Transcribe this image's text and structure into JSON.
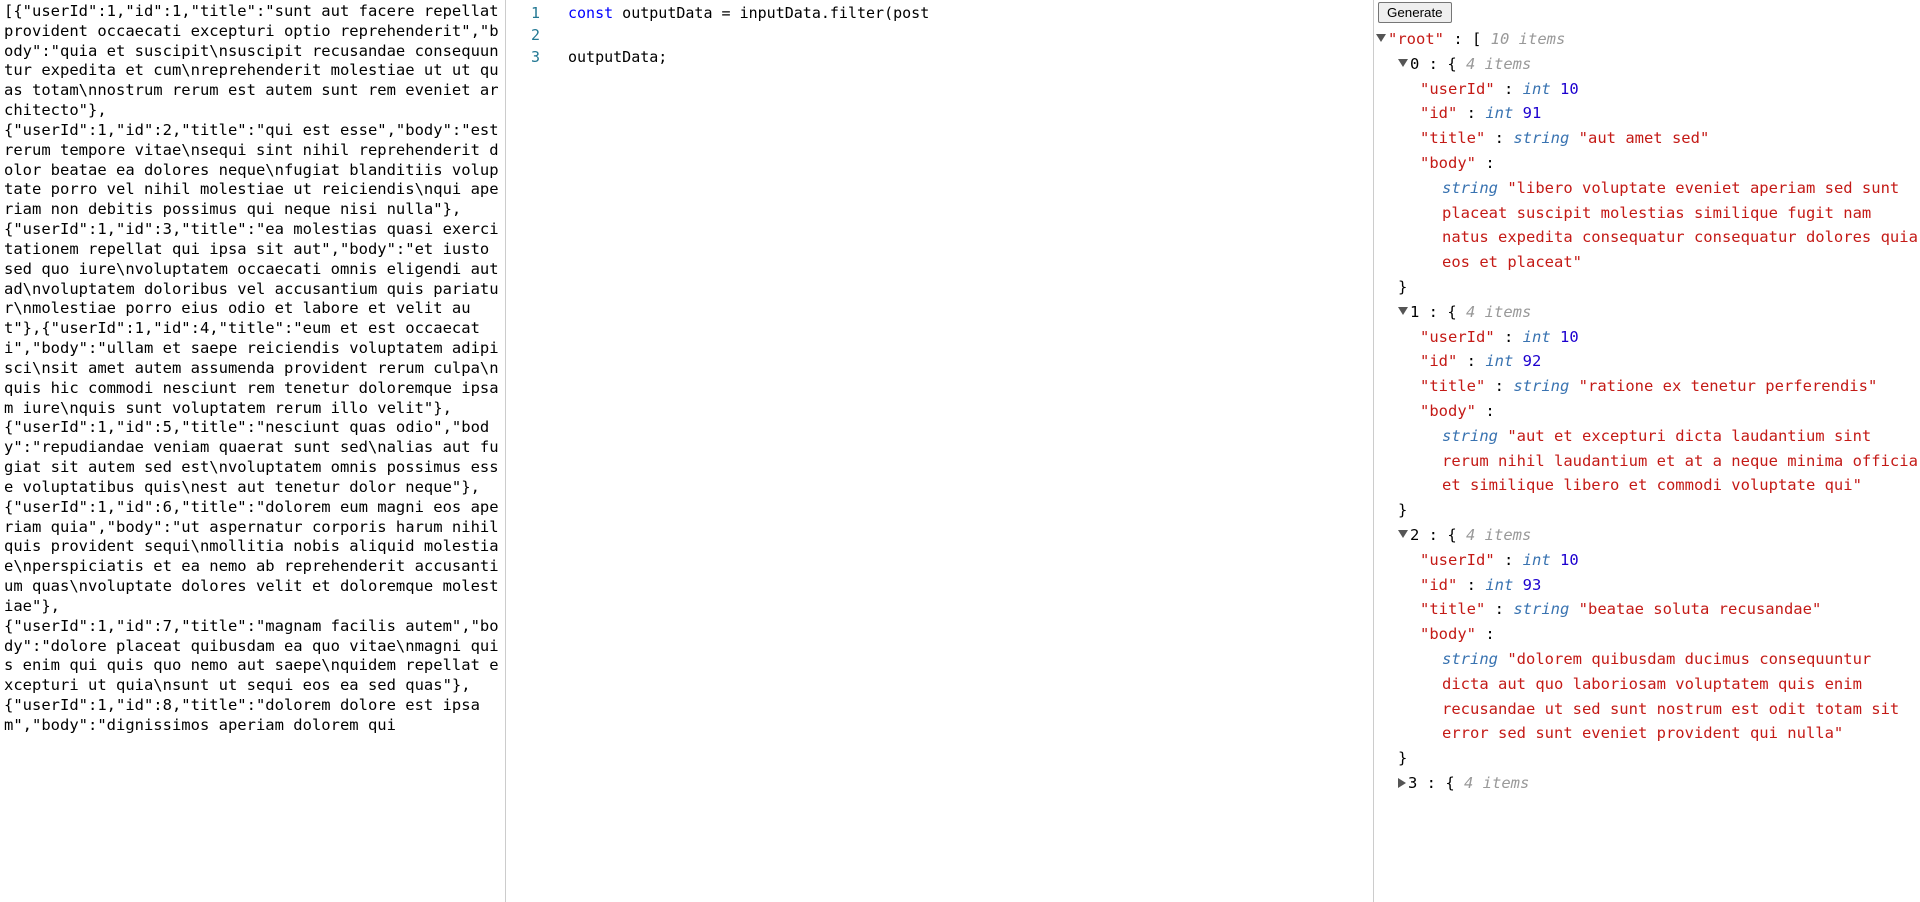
{
  "leftRaw": "[{\"userId\":1,\"id\":1,\"title\":\"sunt aut facere repellat provident occaecati excepturi optio reprehenderit\",\"body\":\"quia et suscipit\\nsuscipit recusandae consequuntur expedita et cum\\nreprehenderit molestiae ut ut quas totam\\nnostrum rerum est autem sunt rem eveniet architecto\"},\n{\"userId\":1,\"id\":2,\"title\":\"qui est esse\",\"body\":\"est rerum tempore vitae\\nsequi sint nihil reprehenderit dolor beatae ea dolores neque\\nfugiat blanditiis voluptate porro vel nihil molestiae ut reiciendis\\nqui aperiam non debitis possimus qui neque nisi nulla\"},\n{\"userId\":1,\"id\":3,\"title\":\"ea molestias quasi exercitationem repellat qui ipsa sit aut\",\"body\":\"et iusto sed quo iure\\nvoluptatem occaecati omnis eligendi aut ad\\nvoluptatem doloribus vel accusantium quis pariatur\\nmolestiae porro eius odio et labore et velit aut\"},{\"userId\":1,\"id\":4,\"title\":\"eum et est occaecati\",\"body\":\"ullam et saepe reiciendis voluptatem adipisci\\nsit amet autem assumenda provident rerum culpa\\nquis hic commodi nesciunt rem tenetur doloremque ipsam iure\\nquis sunt voluptatem rerum illo velit\"},\n{\"userId\":1,\"id\":5,\"title\":\"nesciunt quas odio\",\"body\":\"repudiandae veniam quaerat sunt sed\\nalias aut fugiat sit autem sed est\\nvoluptatem omnis possimus esse voluptatibus quis\\nest aut tenetur dolor neque\"},{\"userId\":1,\"id\":6,\"title\":\"dolorem eum magni eos aperiam quia\",\"body\":\"ut aspernatur corporis harum nihil quis provident sequi\\nmollitia nobis aliquid molestiae\\nperspiciatis et ea nemo ab reprehenderit accusantium quas\\nvoluptate dolores velit et doloremque molestiae\"},\n{\"userId\":1,\"id\":7,\"title\":\"magnam facilis autem\",\"body\":\"dolore placeat quibusdam ea quo vitae\\nmagni quis enim qui quis quo nemo aut saepe\\nquidem repellat excepturi ut quia\\nsunt ut sequi eos ea sed quas\"},\n{\"userId\":1,\"id\":8,\"title\":\"dolorem dolore est ipsam\",\"body\":\"dignissimos aperiam dolorem qui",
  "editor": {
    "lineNumbers": [
      "1",
      "2",
      "3"
    ],
    "code_kw": "const",
    "code_rest": " outputData = inputData.filter(post",
    "line3": "outputData;"
  },
  "right": {
    "generateLabel": "Generate",
    "rootLabel": "\"root\"",
    "rootCount": "10 items",
    "itemCount": "4 items",
    "items": [
      {
        "idx": "0",
        "userId": "10",
        "id": "91",
        "title": "\"aut amet sed\"",
        "body": "\"libero voluptate eveniet aperiam sed sunt placeat suscipit molestias similique fugit nam natus expedita consequatur consequatur dolores quia eos et placeat\""
      },
      {
        "idx": "1",
        "userId": "10",
        "id": "92",
        "title": "\"ratione ex tenetur perferendis\"",
        "body": "\"aut et excepturi dicta laudantium sint rerum nihil laudantium et at a neque minima officia et similique libero et commodi voluptate qui\""
      },
      {
        "idx": "2",
        "userId": "10",
        "id": "93",
        "title": "\"beatae soluta recusandae\"",
        "body": "\"dolorem quibusdam ducimus consequuntur dicta aut quo laboriosam voluptatem quis enim recusandae ut sed sunt nostrum est odit totam sit error sed sunt eveniet provident qui nulla\""
      }
    ],
    "nextIdx": "3",
    "labels": {
      "userId": "\"userId\"",
      "id": "\"id\"",
      "title": "\"title\"",
      "body": "\"body\"",
      "int": "int",
      "string": "string",
      "colon": " : ",
      "openBrace": "{",
      "closeBrace": "}",
      "openBracket": "["
    }
  }
}
